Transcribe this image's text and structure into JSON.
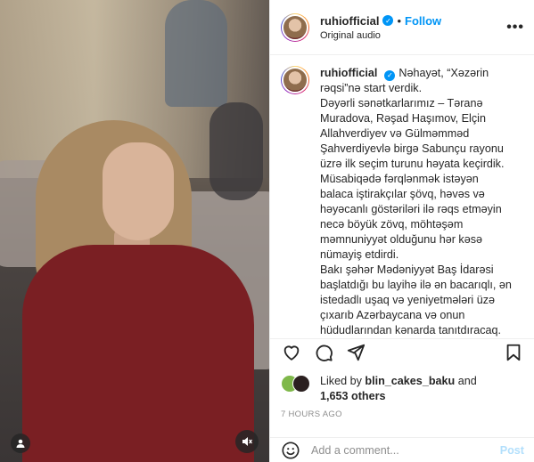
{
  "header": {
    "username": "ruhiofficial",
    "follow_label": "Follow",
    "dot": "•",
    "audio": "Original audio",
    "more": "•••"
  },
  "caption": {
    "username": "ruhiofficial",
    "lines": [
      "Nəhayət, “Xəzərin",
      "rəqsi”nə start verdik.",
      "Dəyərli sənətkarlarımız – Təranə",
      "Muradova, Rəşad Haşımov, Elçin",
      "Allahverdiyev və Gülməmməd",
      "Şahverdiyevlə birgə Sabunçu rayonu",
      "üzrə ilk seçim turunu həyata keçirdik.",
      "Müsabiqədə fərqlənmək istəyən",
      "balaca iştirakçılar şövq, həvəs və",
      "həyəcanlı göstəriləri ilə rəqs etməyin",
      "necə böyük zövq, möhtəşəm",
      "məmnuniyyət olduğunu hər kəsə",
      "nümayiş etdirdi.",
      "Bakı şəhər Mədəniyyət Baş İdarəsi",
      "başlatdığı bu layihə ilə ən bacarıqlı, ən",
      "istedadlı uşaq və yeniyetmələri üzə",
      "çıxarıb Azərbaycana və onun",
      "hüdudlarından kənarda tanıtdıracaq."
    ]
  },
  "likes": {
    "prefix": "Liked by ",
    "user": "blin_cakes_baku",
    "middle": " and",
    "count": "1,653 others"
  },
  "timestamp": "7 HOURS AGO",
  "comment": {
    "placeholder": "Add a comment...",
    "post_label": "Post"
  },
  "icons": {
    "like": "heart-icon",
    "comment": "comment-icon",
    "share": "paper-plane-icon",
    "save": "bookmark-icon",
    "emoji": "smiley-icon",
    "mute": "speaker-muted-icon",
    "tagged": "user-tag-icon"
  },
  "colors": {
    "accent": "#0095f6",
    "post_disabled": "#b2dffc",
    "muted_text": "#8e8e8e"
  }
}
